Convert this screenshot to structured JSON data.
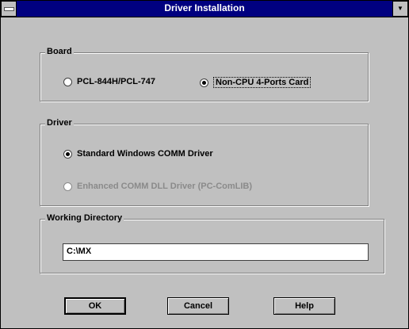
{
  "window": {
    "title": "Driver Installation"
  },
  "board": {
    "title": "Board",
    "options": [
      {
        "label": "PCL-844H/PCL-747",
        "selected": false
      },
      {
        "label": "Non-CPU 4-Ports Card",
        "selected": true
      }
    ]
  },
  "driver": {
    "title": "Driver",
    "options": [
      {
        "label": "Standard Windows COMM Driver",
        "selected": true,
        "enabled": true
      },
      {
        "label": "Enhanced COMM DLL Driver (PC-ComLIB)",
        "selected": false,
        "enabled": false
      }
    ]
  },
  "working_directory": {
    "title": "Working Directory",
    "value": "C:\\MX"
  },
  "buttons": {
    "ok": "OK",
    "cancel": "Cancel",
    "help": "Help"
  }
}
